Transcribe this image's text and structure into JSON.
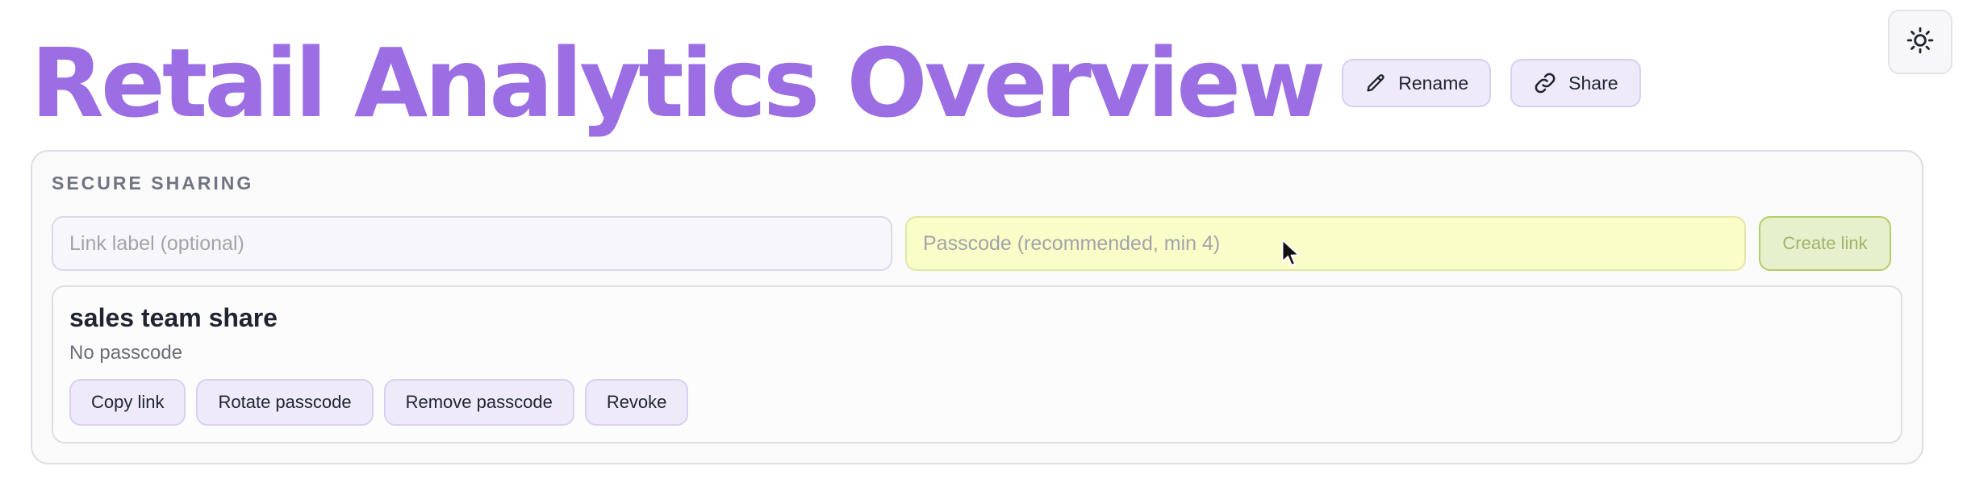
{
  "header": {
    "title": "Retail Analytics Overview",
    "rename_label": "Rename",
    "share_label": "Share",
    "title_color": "#9b6ee4"
  },
  "theme_toggle": {
    "icon": "sun-icon"
  },
  "sharing": {
    "section_label": "SECURE SHARING",
    "label_input": {
      "value": "",
      "placeholder": "Link label (optional)"
    },
    "passcode_input": {
      "value": "",
      "placeholder": "Passcode (recommended, min 4)"
    },
    "create_label": "Create link",
    "links": [
      {
        "name": "sales team share",
        "status": "No passcode",
        "actions": [
          "Copy link",
          "Rotate passcode",
          "Remove passcode",
          "Revoke"
        ]
      }
    ]
  }
}
